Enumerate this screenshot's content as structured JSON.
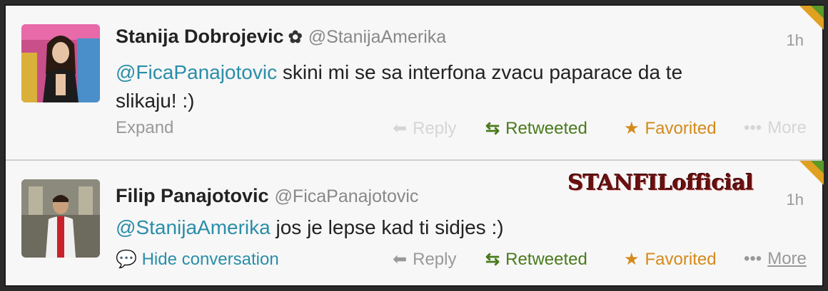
{
  "tweets": [
    {
      "name": "Stanija Dobrojevic",
      "handle": "@StanijaAmerika",
      "time": "1h",
      "mention": "@FicaPanajotovic",
      "text_line1": " skini mi se sa interfona zvacu paparace da te",
      "text_line2": "slikaju! :)",
      "expand": "Expand",
      "reply": "Reply",
      "retweeted": "Retweeted",
      "favorited": "Favorited",
      "more": "More"
    },
    {
      "name": "Filip Panajotovic",
      "handle": "@FicaPanajotovic",
      "time": "1h",
      "mention": "@StanijaAmerika",
      "text": " jos je lepse kad ti sidjes :)",
      "hide_conversation": "Hide conversation",
      "reply": "Reply",
      "retweeted": "Retweeted",
      "favorited": "Favorited",
      "more": "More"
    }
  ],
  "watermark": "STANFILofficial",
  "colors": {
    "link": "#2a8ea8",
    "retweet": "#4a7a1c",
    "favorite": "#d48a1a"
  }
}
